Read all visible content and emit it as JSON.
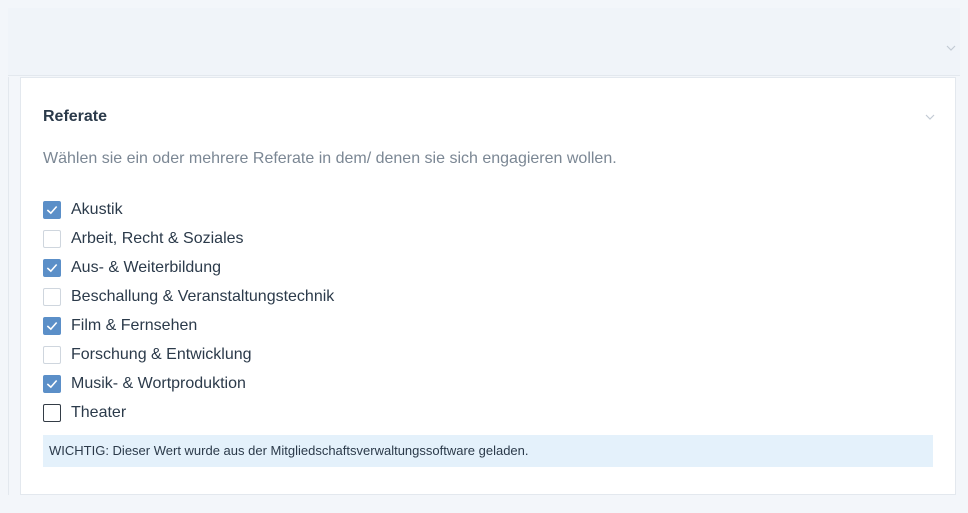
{
  "section": {
    "title": "Referate",
    "description": "Wählen sie ein oder mehrere Referate in dem/ denen sie sich engagieren wollen.",
    "options": [
      {
        "label": "Akustik",
        "checked": true
      },
      {
        "label": "Arbeit, Recht & Soziales",
        "checked": false
      },
      {
        "label": "Aus- & Weiterbildung",
        "checked": true
      },
      {
        "label": "Beschallung & Veranstaltungstechnik",
        "checked": false
      },
      {
        "label": "Film & Fernsehen",
        "checked": true
      },
      {
        "label": "Forschung & Entwicklung",
        "checked": false
      },
      {
        "label": "Musik- & Wortproduktion",
        "checked": true
      },
      {
        "label": "Theater",
        "checked": false
      }
    ],
    "notice": "WICHTIG: Dieser Wert wurde aus der Mitgliedschaftsverwaltungssoftware geladen."
  },
  "icons": {
    "outer_chevron": "chevron-down-icon",
    "card_chevron": "chevron-down-icon",
    "check": "check-icon"
  },
  "colors": {
    "accent": "#5b8fc8",
    "notice_bg": "#e4f1fb",
    "muted_text": "#7b8794"
  }
}
